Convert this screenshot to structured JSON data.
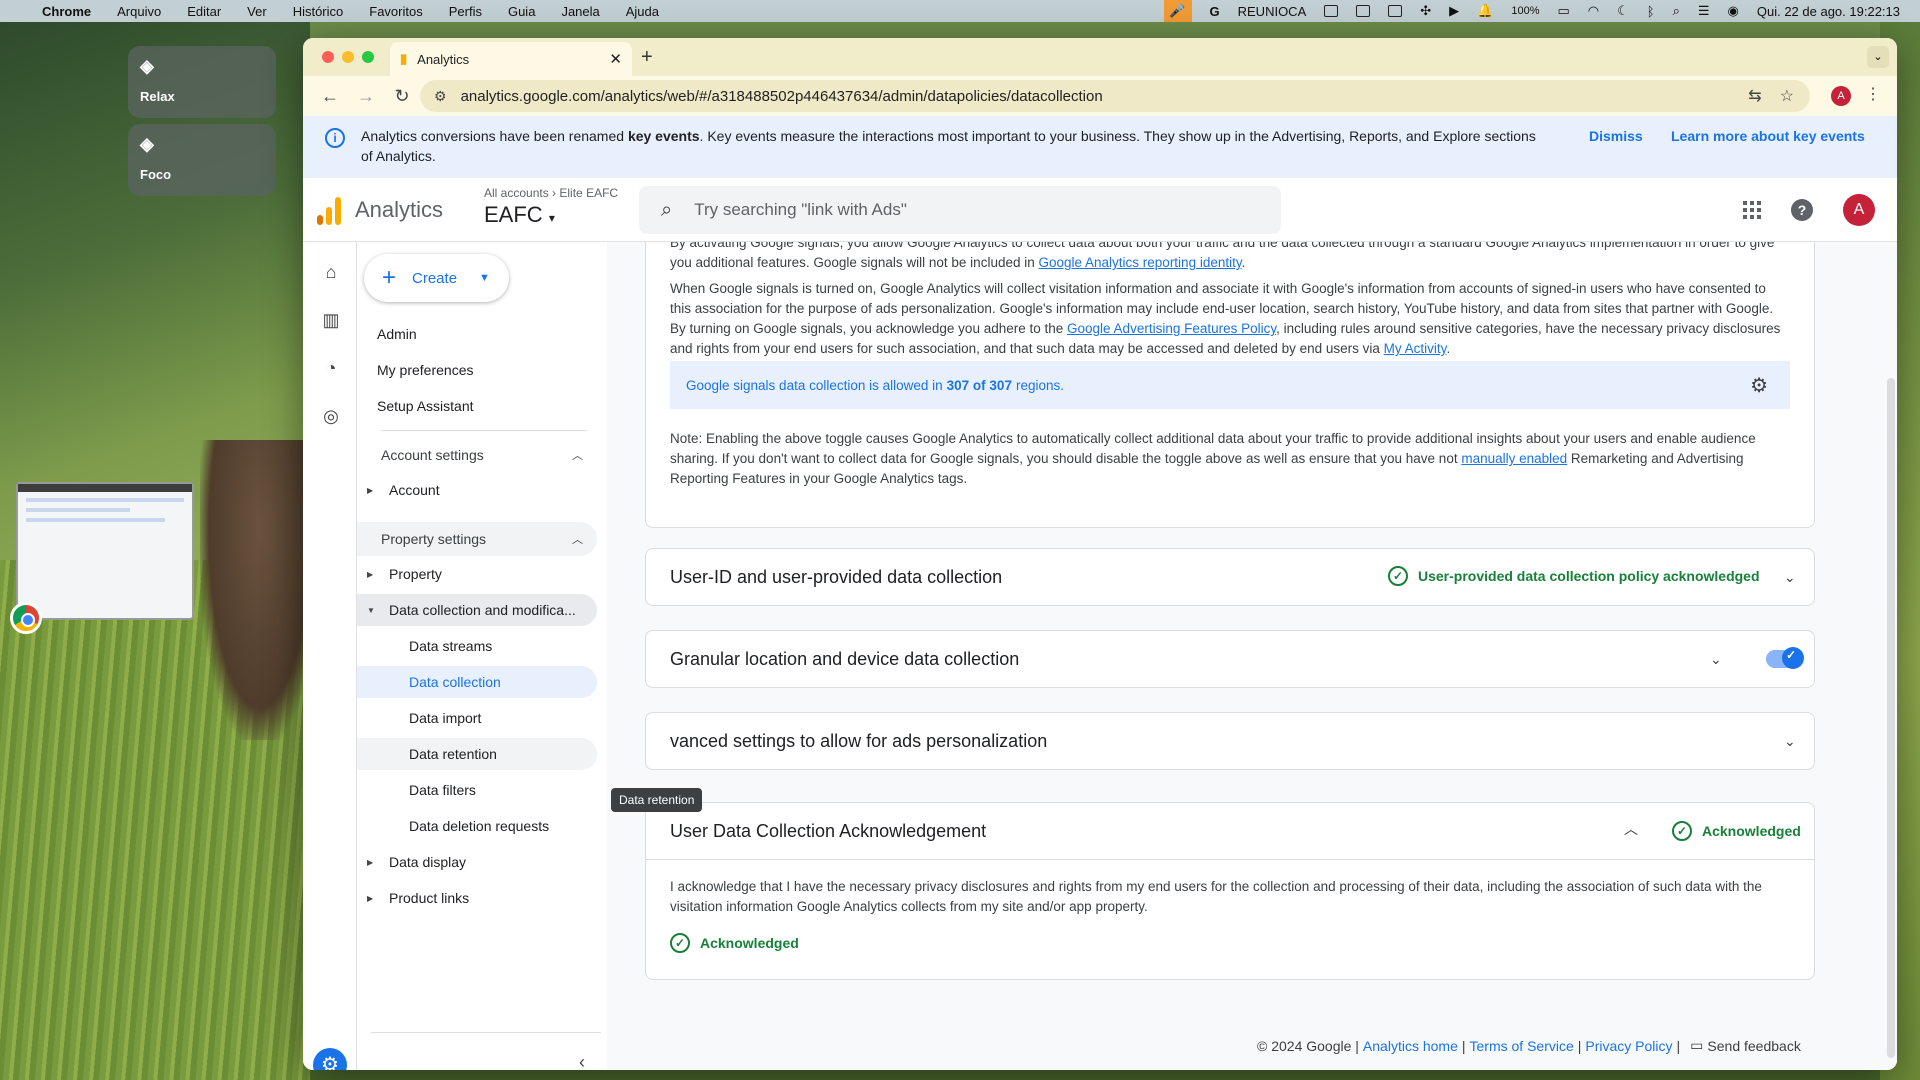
{
  "menubar": {
    "app": "Chrome",
    "items": [
      "Arquivo",
      "Editar",
      "Ver",
      "Histórico",
      "Favoritos",
      "Perfis",
      "Guia",
      "Janela",
      "Ajuda"
    ],
    "status_label": "REUNIOCA",
    "battery": "100%",
    "datetime": "Qui. 22 de ago.  19:22:13"
  },
  "desktop": {
    "focus_modes": [
      "Relax",
      "Foco"
    ]
  },
  "browser": {
    "tab_title": "Analytics",
    "url": "analytics.google.com/analytics/web/#/a318488502p446437634/admin/datapolicies/datacollection",
    "profile_initial": "A"
  },
  "banner": {
    "text_before": "Analytics conversions have been renamed ",
    "text_bold": "key events",
    "text_after": ". Key events measure the interactions most important to your business. They show up in the Advertising, Reports, and Explore sections of Analytics.",
    "dismiss": "Dismiss",
    "learn_more": "Learn more about key events"
  },
  "header": {
    "product": "Analytics",
    "crumb_all": "All accounts",
    "crumb_account": "Elite EAFC",
    "property": "EAFC",
    "search_placeholder": "Try searching \"link with Ads\"",
    "avatar": "A"
  },
  "nav": {
    "create": "Create",
    "admin": "Admin",
    "preferences": "My preferences",
    "setup": "Setup Assistant",
    "account_settings": "Account settings",
    "account": "Account",
    "property_settings": "Property settings",
    "property": "Property",
    "data_collection_mod": "Data collection and modifica...",
    "data_streams": "Data streams",
    "data_collection": "Data collection",
    "data_import": "Data import",
    "data_retention": "Data retention",
    "data_filters": "Data filters",
    "data_deletion": "Data deletion requests",
    "data_display": "Data display",
    "product_links": "Product links"
  },
  "tooltip": "Data retention",
  "signals": {
    "p1_text": "By activating Google signals, you allow Google Analytics to collect data about both your traffic and the data collected through a standard Google Analytics implementation in order to give you additional features. Google signals will not be included in ",
    "p1_link": "Google Analytics reporting identity",
    "p1_end": ".",
    "p2_a": "When Google signals is turned on, Google Analytics will collect visitation information and associate it with Google's information from accounts of signed-in users who have consented to this association for the purpose of ads personalization. Google's information may include end-user location, search history, YouTube history, and data from sites that partner with Google. By turning on Google signals, you acknowledge you adhere to the ",
    "p2_link1": "Google Advertising Features Policy",
    "p2_b": ", including rules around sensitive categories, have the necessary privacy disclosures and rights from your end users for such association, and that such data may be accessed and deleted by end users via ",
    "p2_link2": "My Activity",
    "p2_end": ".",
    "band_before": "Google signals data collection is allowed in",
    "band_bold": "307 of 307",
    "band_after": "regions.",
    "note_a": "Note: Enabling the above toggle causes Google Analytics to automatically collect additional data about your traffic to provide additional insights about your users and enable audience sharing. If you don't want to collect data for Google signals, you should disable the toggle above as well as ensure that you have not ",
    "note_link": "manually enabled",
    "note_b": " Remarketing and Advertising Reporting Features in your Google Analytics tags."
  },
  "cards": {
    "userid_title": "User-ID and user-provided data collection",
    "userid_status": "User-provided data collection policy acknowledged",
    "granular_title": "Granular location and device data collection",
    "granular_enabled": true,
    "advanced_title": "vanced settings to allow for ads personalization",
    "ack_title": "User Data Collection Acknowledgement",
    "ack_status": "Acknowledged",
    "ack_body": "I acknowledge that I have the necessary privacy disclosures and rights from my end users for the collection and processing of their data, including the association of such data with the visitation information Google Analytics collects from my site and/or app property.",
    "ack_bottom": "Acknowledged"
  },
  "footer": {
    "copyright": "© 2024 Google |",
    "home": "Analytics home",
    "sep1": "|",
    "terms": "Terms of Service",
    "sep2": "|",
    "privacy": "Privacy Policy",
    "sep3": "|",
    "feedback": "Send feedback"
  },
  "colors": {
    "accent": "#1a73e8",
    "success": "#188038",
    "banner_bg": "#e8f0fe",
    "ga_orange": "#f9ab00"
  }
}
